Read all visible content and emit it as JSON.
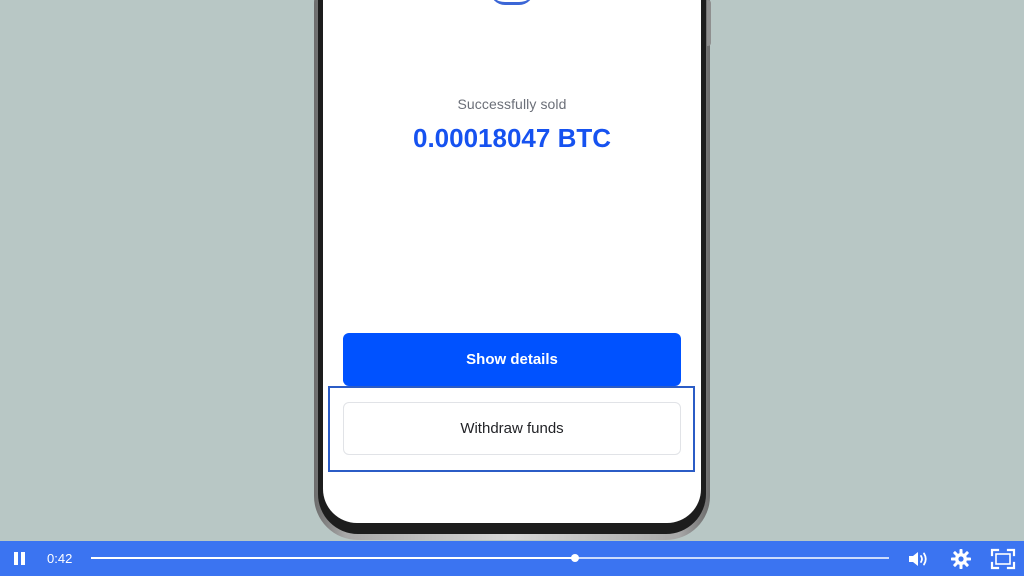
{
  "screen": {
    "status_label": "Successfully sold",
    "amount": "0.00018047 BTC",
    "show_details_label": "Show details",
    "withdraw_label": "Withdraw funds"
  },
  "player": {
    "current_time": "0:42",
    "progress_fraction": 0.607,
    "icons": [
      "pause-icon",
      "volume-icon",
      "settings-icon",
      "fullscreen-icon"
    ]
  },
  "colors": {
    "background": "#b8c7c5",
    "accent_blue": "#0052ff",
    "amount_blue": "#1652f0",
    "control_bar": "#3b74f1",
    "highlight": "#2b5cc6"
  }
}
